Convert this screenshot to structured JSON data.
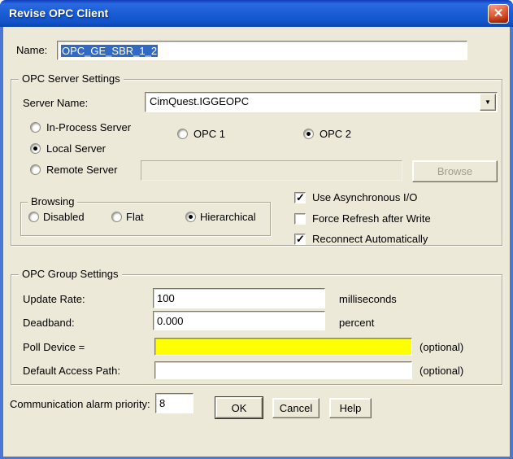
{
  "window": {
    "title": "Revise OPC Client"
  },
  "icons": {
    "close": "✕",
    "dropdown_arrow": "▼",
    "check": "✓"
  },
  "name_row": {
    "label": "Name:",
    "value": "OPC_GE_SBR_1_2"
  },
  "server_settings": {
    "title": "OPC Server Settings",
    "server_name_label": "Server Name:",
    "server_name_value": "CimQuest.IGGEOPC",
    "server_type": [
      {
        "label": "In-Process Server",
        "selected": false
      },
      {
        "label": "Local Server",
        "selected": true
      },
      {
        "label": "Remote Server",
        "selected": false
      }
    ],
    "opc_version": [
      {
        "label": "OPC 1",
        "selected": false
      },
      {
        "label": "OPC 2",
        "selected": true
      }
    ],
    "remote_server_value": "",
    "browse_button": "Browse",
    "browsing": {
      "title": "Browsing",
      "options": [
        {
          "label": "Disabled",
          "selected": false
        },
        {
          "label": "Flat",
          "selected": false
        },
        {
          "label": "Hierarchical",
          "selected": true
        }
      ]
    },
    "options": [
      {
        "label": "Use Asynchronous I/O",
        "checked": true
      },
      {
        "label": "Force Refresh after Write",
        "checked": false
      },
      {
        "label": "Reconnect Automatically",
        "checked": true
      }
    ]
  },
  "group_settings": {
    "title": "OPC Group Settings",
    "update_rate": {
      "label": "Update Rate:",
      "value": "100",
      "suffix": "milliseconds"
    },
    "deadband": {
      "label": "Deadband:",
      "value": "0.000",
      "suffix": "percent"
    },
    "poll_device": {
      "label": "Poll Device =",
      "value": "",
      "suffix": "(optional)"
    },
    "default_access_path": {
      "label": "Default Access Path:",
      "value": "",
      "suffix": "(optional)"
    }
  },
  "footer": {
    "alarm_priority_label": "Communication alarm priority:",
    "alarm_priority_value": "8",
    "ok_button": "OK",
    "cancel_button": "Cancel",
    "help_button": "Help"
  },
  "colors": {
    "dialog_bg": "#ece9d8",
    "titlebar_blue": "#1558cd",
    "frame_blue": "#4a77d4",
    "selection_blue": "#316ac5",
    "highlight_yellow": "#ffff00",
    "close_button_red": "#d94f2b",
    "disabled_text": "#a19e8d"
  }
}
